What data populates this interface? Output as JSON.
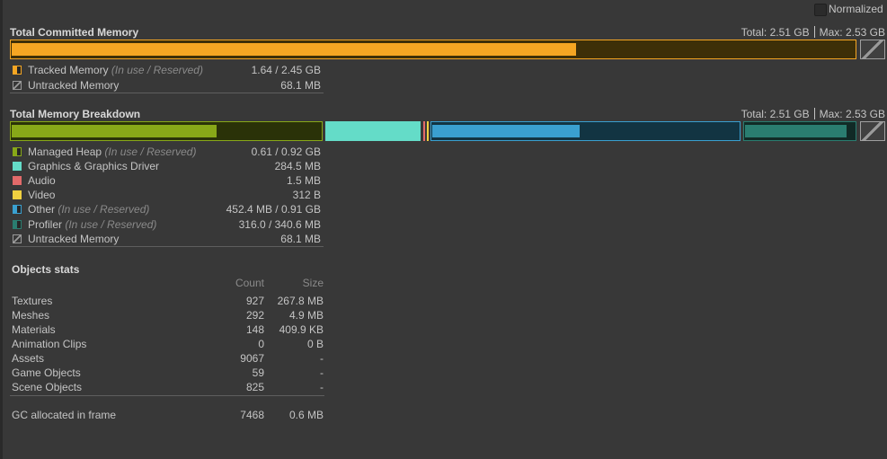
{
  "header": {
    "normalized_label": "Normalized",
    "normalized_checked": false
  },
  "committed": {
    "title": "Total Committed Memory",
    "total_label": "Total: 2.51 GB",
    "max_label": "Max: 2.53 GB",
    "tracked_in_use_fraction": 0.669,
    "legend": [
      {
        "label": "Tracked Memory",
        "note": "(In use / Reserved)",
        "value": "1.64 / 2.45 GB",
        "color": "#f5a623",
        "icon": "half-filled"
      },
      {
        "label": "Untracked Memory",
        "note": "",
        "value": "68.1 MB",
        "color": "#8a8a8a",
        "icon": "hatched"
      }
    ]
  },
  "breakdown": {
    "title": "Total Memory Breakdown",
    "total_label": "Total: 2.51 GB",
    "max_label": "Max: 2.53 GB",
    "managed_heap_in_use_fraction": 0.663,
    "other_in_use_fraction": 0.481,
    "profiler_in_use_fraction": 0.928,
    "legend": [
      {
        "label": "Managed Heap",
        "note": "(In use / Reserved)",
        "value": "0.61 / 0.92 GB",
        "color": "#88a818",
        "icon": "half-filled"
      },
      {
        "label": "Graphics & Graphics Driver",
        "note": "",
        "value": "284.5 MB",
        "color": "#64dcc8",
        "icon": "solid"
      },
      {
        "label": "Audio",
        "note": "",
        "value": "1.5 MB",
        "color": "#e26a6a",
        "icon": "solid"
      },
      {
        "label": "Video",
        "note": "",
        "value": "312 B",
        "color": "#f0d040",
        "icon": "solid"
      },
      {
        "label": "Other",
        "note": "(In use / Reserved)",
        "value": "452.4 MB / 0.91 GB",
        "color": "#3aa0d0",
        "icon": "half-filled"
      },
      {
        "label": "Profiler",
        "note": "(In use / Reserved)",
        "value": "316.0 / 340.6 MB",
        "color": "#2a7d70",
        "icon": "half-filled"
      },
      {
        "label": "Untracked Memory",
        "note": "",
        "value": "68.1 MB",
        "color": "#8a8a8a",
        "icon": "hatched"
      }
    ]
  },
  "objects": {
    "title": "Objects stats",
    "col_count": "Count",
    "col_size": "Size",
    "rows": [
      {
        "name": "Textures",
        "count": "927",
        "size": "267.8 MB"
      },
      {
        "name": "Meshes",
        "count": "292",
        "size": "4.9 MB"
      },
      {
        "name": "Materials",
        "count": "148",
        "size": "409.9 KB"
      },
      {
        "name": "Animation Clips",
        "count": "0",
        "size": "0 B"
      },
      {
        "name": "Assets",
        "count": "9067",
        "size": "-"
      },
      {
        "name": "Game Objects",
        "count": "59",
        "size": "-"
      },
      {
        "name": "Scene Objects",
        "count": "825",
        "size": "-"
      }
    ],
    "gc": {
      "name": "GC allocated in frame",
      "count": "7468",
      "size": "0.6 MB"
    }
  }
}
